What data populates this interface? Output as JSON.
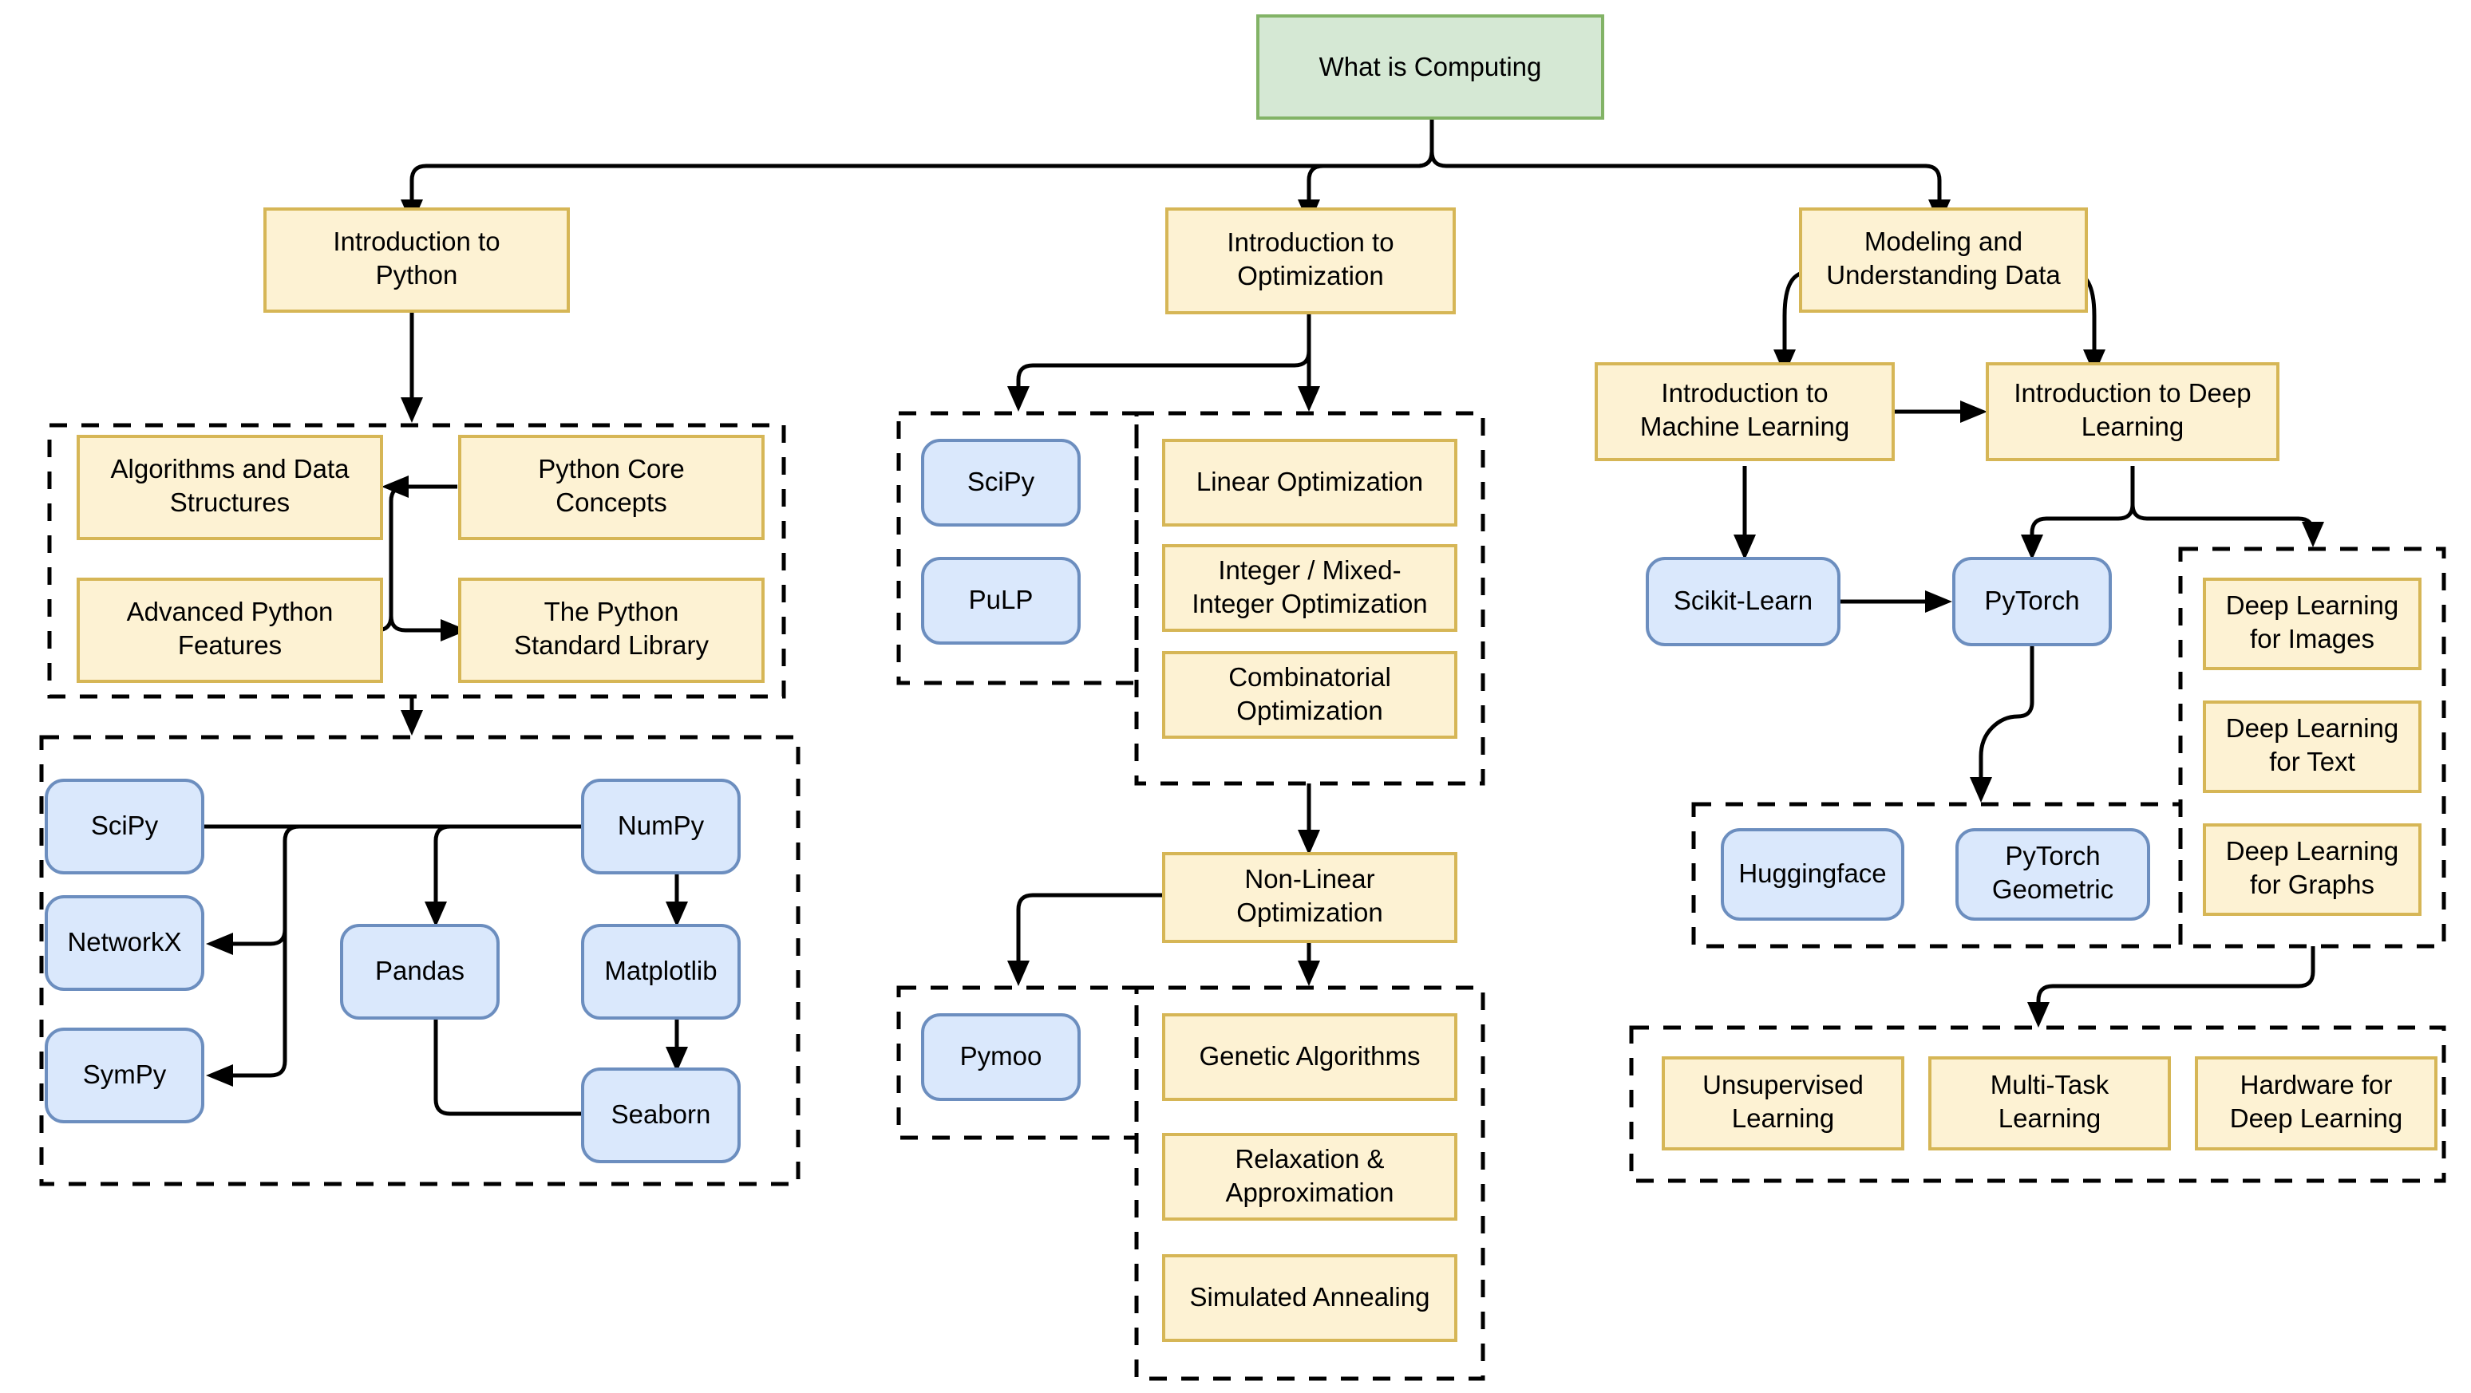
{
  "diagram": {
    "title": "What is Computing",
    "type": "flowchart",
    "orientation": "top-down",
    "colors": {
      "root_fill": "#d5e8d4",
      "root_stroke": "#82b366",
      "topic_fill": "#fdf2d3",
      "topic_stroke": "#d6b656",
      "library_fill": "#dae8fc",
      "library_stroke": "#6c8ebf",
      "edge": "#000000",
      "cluster_border": "#000000",
      "background": "#ffffff"
    },
    "nodes": {
      "root": {
        "label": "What is Computing",
        "kind": "root"
      },
      "intro_python": {
        "label": "Introduction to\nPython",
        "kind": "topic"
      },
      "intro_optimization": {
        "label": "Introduction to\nOptimization",
        "kind": "topic"
      },
      "modeling_data": {
        "label": "Modeling and\nUnderstanding Data",
        "kind": "topic"
      },
      "algorithms_data_structures": {
        "label": "Algorithms and Data\nStructures",
        "kind": "topic"
      },
      "python_core_concepts": {
        "label": "Python Core\nConcepts",
        "kind": "topic"
      },
      "advanced_python_features": {
        "label": "Advanced Python\nFeatures",
        "kind": "topic"
      },
      "python_standard_library": {
        "label": "The Python\nStandard Library",
        "kind": "topic"
      },
      "scipy_py": {
        "label": "SciPy",
        "kind": "library"
      },
      "networkx": {
        "label": "NetworkX",
        "kind": "library"
      },
      "sympy": {
        "label": "SymPy",
        "kind": "library"
      },
      "pandas": {
        "label": "Pandas",
        "kind": "library"
      },
      "numpy": {
        "label": "NumPy",
        "kind": "library"
      },
      "matplotlib": {
        "label": "Matplotlib",
        "kind": "library"
      },
      "seaborn": {
        "label": "Seaborn",
        "kind": "library"
      },
      "scipy_opt": {
        "label": "SciPy",
        "kind": "library"
      },
      "pulp": {
        "label": "PuLP",
        "kind": "library"
      },
      "linear_optimization": {
        "label": "Linear Optimization",
        "kind": "topic"
      },
      "integer_optimization": {
        "label": "Integer / Mixed-\nInteger Optimization",
        "kind": "topic"
      },
      "combinatorial_optimization": {
        "label": "Combinatorial\nOptimization",
        "kind": "topic"
      },
      "nonlinear_optimization": {
        "label": "Non-Linear\nOptimization",
        "kind": "topic"
      },
      "pymoo": {
        "label": "Pymoo",
        "kind": "library"
      },
      "genetic_algorithms": {
        "label": "Genetic Algorithms",
        "kind": "topic"
      },
      "relaxation_approximation": {
        "label": "Relaxation &\nApproximation",
        "kind": "topic"
      },
      "simulated_annealing": {
        "label": "Simulated Annealing",
        "kind": "topic"
      },
      "intro_ml": {
        "label": "Introduction to\nMachine Learning",
        "kind": "topic"
      },
      "intro_dl": {
        "label": "Introduction to Deep\nLearning",
        "kind": "topic"
      },
      "scikit_learn": {
        "label": "Scikit-Learn",
        "kind": "library"
      },
      "pytorch": {
        "label": "PyTorch",
        "kind": "library"
      },
      "huggingface": {
        "label": "Huggingface",
        "kind": "library"
      },
      "pytorch_geometric": {
        "label": "PyTorch\nGeometric",
        "kind": "library"
      },
      "dl_images": {
        "label": "Deep Learning\nfor Images",
        "kind": "topic"
      },
      "dl_text": {
        "label": "Deep Learning\nfor Text",
        "kind": "topic"
      },
      "dl_graphs": {
        "label": "Deep Learning\nfor Graphs",
        "kind": "topic"
      },
      "unsupervised_learning": {
        "label": "Unsupervised\nLearning",
        "kind": "topic"
      },
      "multitask_learning": {
        "label": "Multi-Task\nLearning",
        "kind": "topic"
      },
      "hardware_deep_learning": {
        "label": "Hardware for\nDeep Learning",
        "kind": "topic"
      }
    },
    "edges": [
      {
        "from": "root",
        "to": "intro_python"
      },
      {
        "from": "root",
        "to": "intro_optimization"
      },
      {
        "from": "root",
        "to": "modeling_data"
      },
      {
        "from": "intro_python",
        "to": "python_concepts_cluster"
      },
      {
        "from": "python_core_concepts",
        "to": "algorithms_data_structures"
      },
      {
        "from": "advanced_python_features",
        "to": "python_standard_library",
        "bidirectional": true
      },
      {
        "from": "python_concepts_cluster",
        "to": "python_libraries_cluster"
      },
      {
        "from": "numpy",
        "to": "scipy_py"
      },
      {
        "from": "numpy",
        "to": "networkx"
      },
      {
        "from": "numpy",
        "to": "sympy"
      },
      {
        "from": "numpy",
        "to": "pandas"
      },
      {
        "from": "numpy",
        "to": "matplotlib"
      },
      {
        "from": "matplotlib",
        "to": "seaborn"
      },
      {
        "from": "pandas",
        "to": "seaborn"
      },
      {
        "from": "intro_optimization",
        "to": "optimization_libs_cluster"
      },
      {
        "from": "intro_optimization",
        "to": "optimization_topics_cluster"
      },
      {
        "from": "optimization_topics_cluster",
        "to": "nonlinear_optimization"
      },
      {
        "from": "nonlinear_optimization",
        "to": "nonlinear_libs_cluster"
      },
      {
        "from": "nonlinear_optimization",
        "to": "nonlinear_topics_cluster"
      },
      {
        "from": "modeling_data",
        "to": "intro_ml"
      },
      {
        "from": "modeling_data",
        "to": "intro_dl"
      },
      {
        "from": "intro_ml",
        "to": "intro_dl"
      },
      {
        "from": "intro_ml",
        "to": "scikit_learn"
      },
      {
        "from": "intro_dl",
        "to": "pytorch"
      },
      {
        "from": "intro_dl",
        "to": "dl_topics_cluster"
      },
      {
        "from": "scikit_learn",
        "to": "pytorch"
      },
      {
        "from": "pytorch",
        "to": "dl_libs_cluster"
      },
      {
        "from": "dl_topics_cluster",
        "to": "advanced_topics_cluster"
      }
    ]
  }
}
